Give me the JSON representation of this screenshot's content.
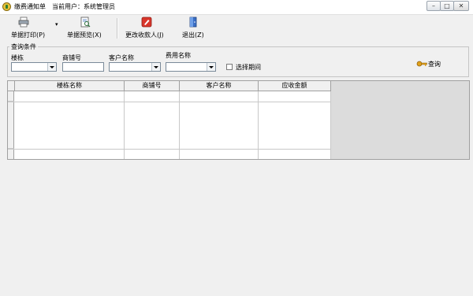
{
  "window": {
    "title": "缴费通知单",
    "current_user": "当前用户：系统管理员",
    "min_label": "–",
    "max_label": "□",
    "close_label": "✕"
  },
  "toolbar": {
    "print_label": "单据打印(P)",
    "preview_label": "单据预览(X)",
    "change_payee_label": "更改收款人(J)",
    "exit_label": "退出(Z)",
    "dropdown_mark": "▾"
  },
  "query": {
    "group_title": "查询条件",
    "building_label": "楼栋",
    "shop_no_label": "商铺号",
    "customer_label": "客户名称",
    "fee_name_label": "费用名称",
    "select_period_label": "选择期间",
    "query_button_label": "查询",
    "building_value": "",
    "shop_no_value": "",
    "customer_value": "",
    "fee_name_value": ""
  },
  "table": {
    "columns": [
      "楼栋名称",
      "商铺号",
      "客户名称",
      "应收金额"
    ],
    "rows": []
  },
  "icons": [
    "app-icon",
    "printer-icon",
    "preview-icon",
    "edit-icon",
    "exit-door-icon",
    "key-icon"
  ]
}
